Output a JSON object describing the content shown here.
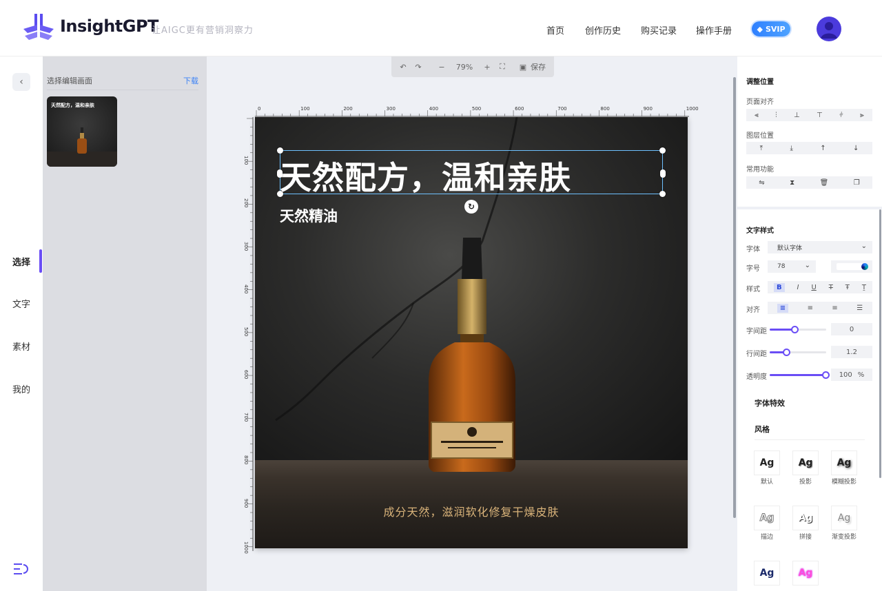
{
  "header": {
    "brand": "InsightGPT",
    "slogan": "让AIGC更有营销洞察力",
    "nav": [
      "首页",
      "创作历史",
      "购买记录",
      "操作手册"
    ],
    "vip_label": "SVIP"
  },
  "leftnav": {
    "items": [
      "选择",
      "文字",
      "素材",
      "我的"
    ],
    "active": "选择"
  },
  "pages_panel": {
    "title": "选择编辑画面",
    "download": "下载",
    "thumb_title": "天然配方，温和亲肤"
  },
  "toolbar": {
    "zoom": "79%",
    "save_label": "保存"
  },
  "ruler": {
    "h_ticks": [
      "0",
      "100",
      "200",
      "300",
      "400",
      "500",
      "600",
      "700",
      "800",
      "900",
      "1000"
    ],
    "v_ticks": [
      "100",
      "200",
      "300",
      "400",
      "500",
      "600",
      "700",
      "800",
      "900",
      "1000"
    ]
  },
  "poster": {
    "headline": "天然配方，温和亲肤",
    "subheadline": "天然精油",
    "footer": "成分天然，滋润软化修复干燥皮肤"
  },
  "rightpanel": {
    "position_title": "调整位置",
    "page_align_label": "页面对齐",
    "layer_pos_label": "图层位置",
    "common_func_label": "常用功能",
    "text_style_title": "文字样式",
    "font_label": "字体",
    "font_value": "默认字体",
    "size_label": "字号",
    "size_value": "78",
    "style_label": "样式",
    "align_label": "对齐",
    "letter_spacing_label": "字间距",
    "letter_spacing_value": "0",
    "line_height_label": "行间距",
    "line_height_value": "1.2",
    "opacity_label": "透明度",
    "opacity_value": "100",
    "opacity_unit": "%",
    "effects_title": "字体特效",
    "style_section": "风格",
    "effects": [
      {
        "name": "默认"
      },
      {
        "name": "投影"
      },
      {
        "name": "模糊投影"
      },
      {
        "name": "描边"
      },
      {
        "name": "拼接"
      },
      {
        "name": "渐变投影"
      },
      {
        "name": ""
      },
      {
        "name": ""
      }
    ],
    "sample_text": "Ag",
    "letter_spacing_level": 0.45,
    "line_height_level": 0.3,
    "opacity_level": 1.0
  },
  "colors": {
    "accent": "#6a4df5",
    "selection": "#6ec1ff",
    "footer_text": "#d9b37a"
  }
}
